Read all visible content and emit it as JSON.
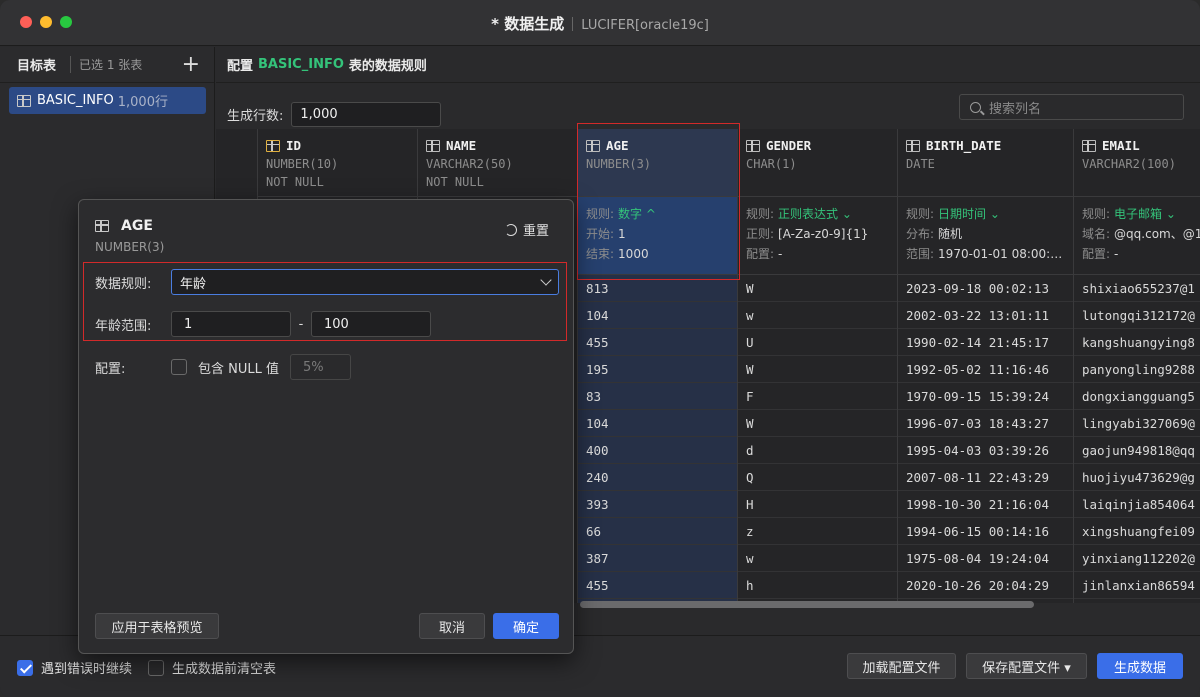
{
  "window": {
    "title": "* 数据生成",
    "connection": "LUCIFER[oracle19c]"
  },
  "sidebar": {
    "title": "目标表",
    "selected_text": "已选 1 张表",
    "add_label": "+",
    "items": [
      {
        "name": "BASIC_INFO",
        "count": "1,000行"
      }
    ]
  },
  "main": {
    "header_prefix": "配置",
    "table_name": "BASIC_INFO",
    "header_suffix": "表的数据规则",
    "rows_label": "生成行数:",
    "rows_value": "1,000",
    "search_placeholder": "搜索列名"
  },
  "grid": {
    "columns": [
      {
        "name": "ID",
        "type": "NUMBER(10)",
        "nullable": "NOT NULL"
      },
      {
        "name": "NAME",
        "type": "VARCHAR2(50)",
        "nullable": "NOT NULL"
      },
      {
        "name": "AGE",
        "type": "NUMBER(3)",
        "nullable": "",
        "rule": [
          {
            "k": "规则:",
            "v": "数字 ^",
            "accent": true
          },
          {
            "k": "开始:",
            "v": "1"
          },
          {
            "k": "结束:",
            "v": "1000"
          }
        ],
        "values": [
          "813",
          "104",
          "455",
          "195",
          "83",
          "104",
          "400",
          "240",
          "393",
          "66",
          "387",
          "455"
        ]
      },
      {
        "name": "GENDER",
        "type": "CHAR(1)",
        "nullable": "",
        "rule": [
          {
            "k": "规则:",
            "v": "正则表达式 ⌄",
            "accent": true
          },
          {
            "k": "正则:",
            "v": "[A-Za-z0-9]{1}"
          },
          {
            "k": "配置:",
            "v": "-"
          }
        ],
        "values": [
          "W",
          "w",
          "U",
          "W",
          "F",
          "W",
          "d",
          "Q",
          "H",
          "z",
          "w",
          "h"
        ]
      },
      {
        "name": "BIRTH_DATE",
        "type": "DATE",
        "nullable": "",
        "rule": [
          {
            "k": "规则:",
            "v": "日期时间 ⌄",
            "accent": true
          },
          {
            "k": "分布:",
            "v": "随机"
          },
          {
            "k": "范围:",
            "v": "1970-01-01 08:00:…"
          }
        ],
        "values": [
          "2023-09-18 00:02:13",
          "2002-03-22 13:01:11",
          "1990-02-14 21:45:17",
          "1992-05-02 11:16:46",
          "1970-09-15 15:39:24",
          "1996-07-03 18:43:27",
          "1995-04-03 03:39:26",
          "2007-08-11 22:43:29",
          "1998-10-30 21:16:04",
          "1994-06-15 00:14:16",
          "1975-08-04 19:24:04",
          "2020-10-26 20:04:29"
        ]
      },
      {
        "name": "EMAIL",
        "type": "VARCHAR2(100)",
        "nullable": "",
        "rule": [
          {
            "k": "规则:",
            "v": "电子邮箱 ⌄",
            "accent": true
          },
          {
            "k": "域名:",
            "v": "@qq.com、@1"
          },
          {
            "k": "配置:",
            "v": "-"
          }
        ],
        "values": [
          "shixiao655237@1",
          "lutongqi312172@",
          "kangshuangying8",
          "panyongling9288",
          "dongxiangguang5",
          "lingyabi327069@",
          "gaojun949818@qq",
          "huojiyu473629@g",
          "laiqinjia854064",
          "xingshuangfei09",
          "yinxiang112202@",
          "jinlanxian86594"
        ]
      }
    ]
  },
  "dialog": {
    "column": "AGE",
    "type": "NUMBER(3)",
    "reset_label": "重置",
    "rule_label": "数据规则:",
    "rule_value": "年龄",
    "range_label": "年龄范围:",
    "range_from": "1",
    "range_sep": "-",
    "range_to": "100",
    "config_label": "配置:",
    "null_label": "包含 NULL 值",
    "null_pct": "5%",
    "apply_label": "应用于表格预览",
    "cancel_label": "取消",
    "ok_label": "确定"
  },
  "footer": {
    "continue_on_error": "遇到错误时继续",
    "clear_before": "生成数据前清空表",
    "load_config": "加载配置文件",
    "save_config": "保存配置文件 ▾",
    "generate": "生成数据"
  },
  "colors": {
    "accent_green": "#34c37a",
    "primary_blue": "#3a6ee8",
    "highlight_red": "#d22a2a",
    "traffic_red": "#ff5f57",
    "traffic_yellow": "#febc2e",
    "traffic_green": "#28c840"
  }
}
